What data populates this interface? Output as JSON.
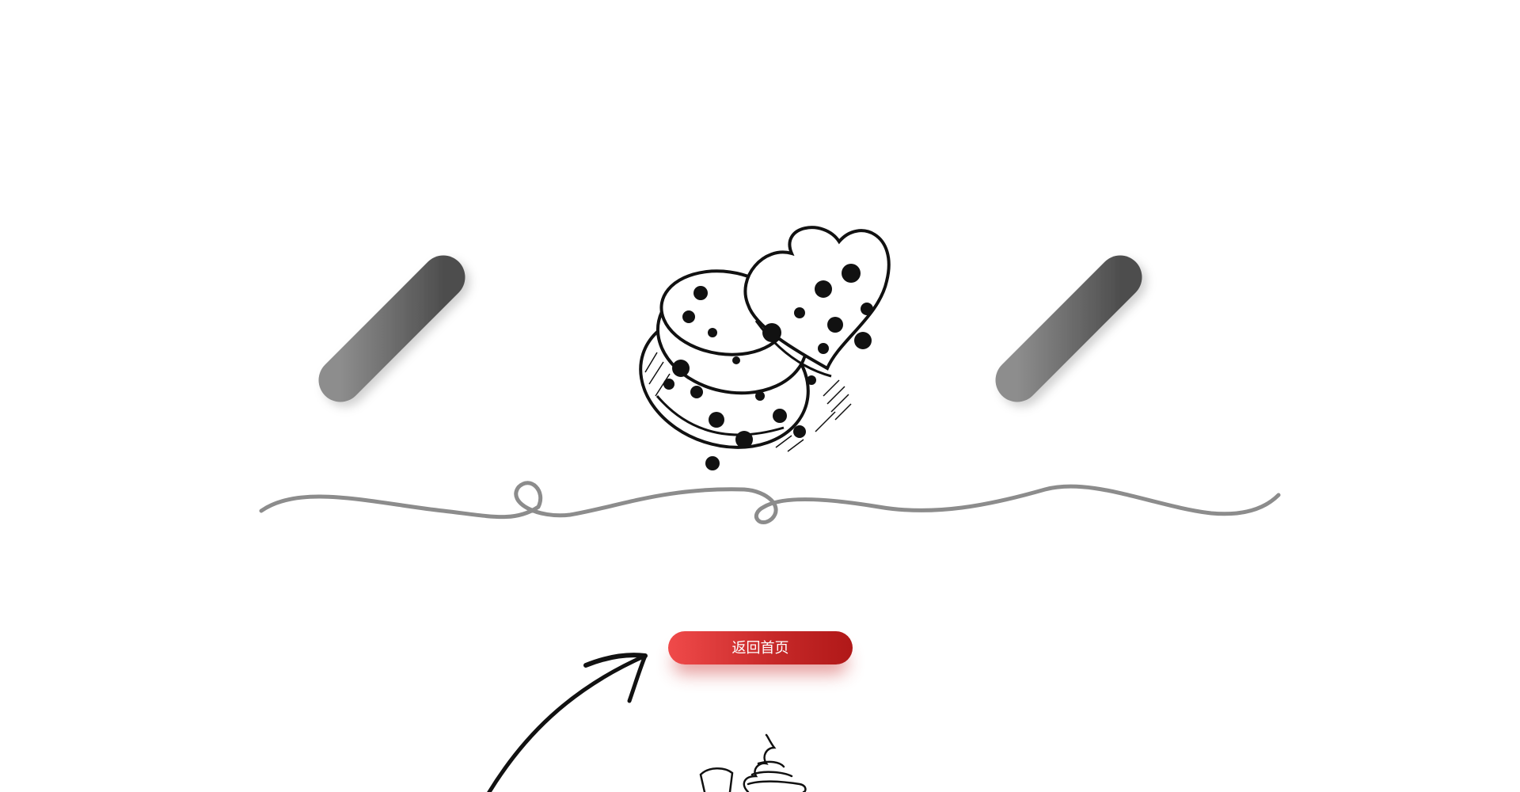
{
  "home_button": {
    "label": "返回首页"
  },
  "colors": {
    "background": "#ffffff",
    "digit_light": "#8a8a8a",
    "digit_dark": "#4f4f4f",
    "squiggle": "#8c8c8c",
    "button_start": "#f04a4a",
    "button_end": "#b01818",
    "sketch_ink": "#111111"
  },
  "icons": {
    "center_illustration": "cookie-stack-icon",
    "arrow": "hand-drawn-arrow-icon",
    "bottom_sketch": "ice-cream-sketch-icon"
  }
}
